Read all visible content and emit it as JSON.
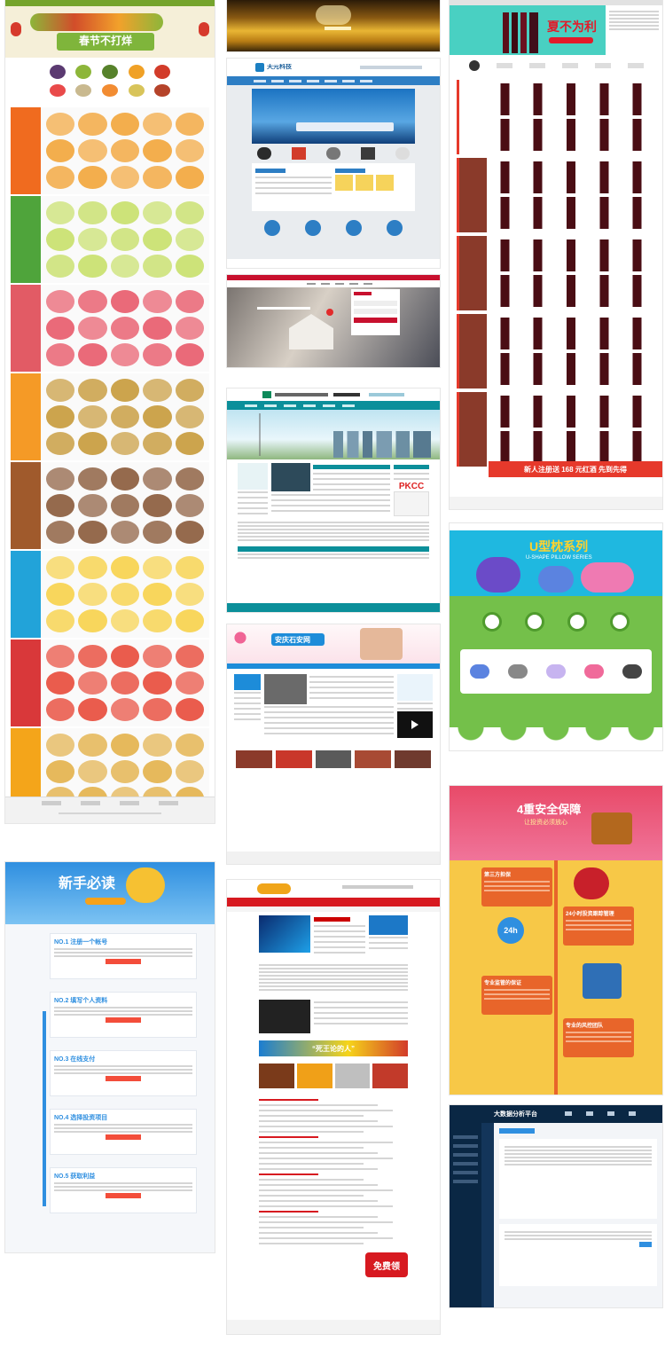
{
  "fruit": {
    "banner_text": "春节不打烊",
    "section_colors": [
      "#f06b1f",
      "#4fa43b",
      "#e25b65",
      "#f59a26",
      "#a05a2c",
      "#22a3d9",
      "#d9383a",
      "#f4a51a"
    ],
    "footer": [
      "",
      "",
      "",
      "",
      ""
    ]
  },
  "landscape": {
    "title": ""
  },
  "corp": {
    "logo_text": "天元科技",
    "nav": [
      "",
      "",
      "",
      "",
      "",
      "",
      ""
    ]
  },
  "hotel": {
    "tagline": "",
    "login_title": ""
  },
  "power": {
    "logo_text": "",
    "company": "",
    "pkcc": "PKCC"
  },
  "school": {
    "logo_text": "安庆石安网"
  },
  "wine": {
    "banner_text": "夏不为利",
    "promo_text": "新人注册送 168 元红酒 先到先得",
    "section_colors": [
      "#e6392b",
      "#e6392b",
      "#e6392b",
      "#e6392b",
      "#e6392b"
    ]
  },
  "pillow": {
    "title": "U型枕系列",
    "subtitle": "U-SHAPE PILLOW SERIES",
    "pills": [
      "",
      "",
      "",
      ""
    ]
  },
  "guide": {
    "title": "新手必读",
    "steps": [
      "NO.1 注册一个帐号",
      "NO.2 填写个人资料",
      "NO.3 在线支付",
      "NO.4 选择投资项目",
      "NO.5 获取利益"
    ]
  },
  "news": {
    "logo_text": "",
    "video_text": "",
    "banner_text": "“死王论的人”",
    "free_badge": "免费领"
  },
  "security": {
    "title": "4重安全保障",
    "sub": "让投资必须放心",
    "items": [
      "第三方担保",
      "24小时投资跟踪管理",
      "专业监管的保证",
      "专业的风控团队"
    ],
    "badge_24h": "24h"
  },
  "admin": {
    "title": "大数据分析平台",
    "menu": [
      "",
      "",
      "",
      "",
      "",
      ""
    ]
  }
}
